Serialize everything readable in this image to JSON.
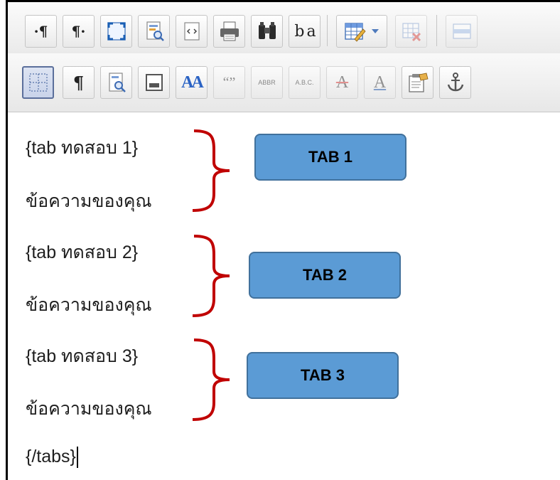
{
  "toolbar": {
    "row1": {
      "ltr_mark": "·¶",
      "rtl_mark": "¶·",
      "bidi_label": "b a",
      "icons": [
        "paragraph-ltr-icon",
        "paragraph-rtl-icon",
        "fullscreen-icon",
        "preview-icon",
        "source-code-icon",
        "print-icon",
        "find-binoculars-icon",
        "replace-icon",
        "insert-table-icon",
        "dropdown-arrow-icon",
        "delete-table-icon",
        "table-row-icon"
      ]
    },
    "row2": {
      "pilcrow": "¶",
      "font_size_label": "AA",
      "quote_label": "“”",
      "abbr_label": "ABBR",
      "acronym_label": "A.B.C.",
      "strike_label": "A",
      "underline_label": "A",
      "icons": [
        "visual-aid-grid-icon",
        "show-blocks-icon",
        "preview-page-icon",
        "page-break-icon",
        "font-size-icon",
        "blockquote-icon",
        "abbreviation-icon",
        "acronym-icon",
        "strikethrough-icon",
        "insert-text-icon",
        "template-icon",
        "anchor-icon"
      ]
    }
  },
  "editor": {
    "lines": [
      "{tab ทดสอบ 1}",
      "ข้อความของคุณ",
      "{tab ทดสอบ 2}",
      "ข้อความของคุณ",
      "{tab ทดสอบ 3}",
      "ข้อความของคุณ",
      "{/tabs}"
    ]
  },
  "callouts": {
    "tab1": "TAB 1",
    "tab2": "TAB 2",
    "tab3": "TAB 3"
  },
  "colors": {
    "callout_fill": "#5b9bd5",
    "callout_border": "#41719c",
    "brace": "#c00000",
    "active_button": "#5b6f9b"
  }
}
